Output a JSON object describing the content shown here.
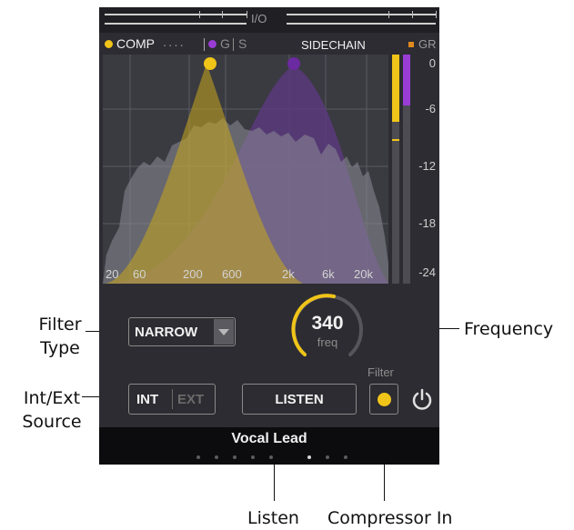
{
  "colors": {
    "accent_yellow": "#f0c419",
    "sidechain_purple": "#9a3cd6",
    "gr_orange": "#e08a1e",
    "panel_bg": "#2c2c32"
  },
  "topbar": {
    "io_label": "I/O"
  },
  "header": {
    "comp_label": "COMP",
    "comp_dots": "....",
    "g_label": "G",
    "s_label": "S",
    "sidechain_label": "SIDECHAIN",
    "gr_label": "GR"
  },
  "graph": {
    "freq_labels": [
      "20",
      "60",
      "200",
      "600",
      "2k",
      "6k",
      "20k"
    ]
  },
  "gr_meter": {
    "ticks": [
      "0",
      "-6",
      "-12",
      "-18",
      "-24"
    ]
  },
  "filter_type": {
    "value": "NARROW"
  },
  "frequency_knob": {
    "value": "340",
    "unit": "freq"
  },
  "source": {
    "int_label": "INT",
    "ext_label": "EXT"
  },
  "listen_button": {
    "label": "LISTEN"
  },
  "compressor_in": {
    "label": "Filter"
  },
  "footer": {
    "preset_name": "Vocal Lead",
    "page_count": 8,
    "current_page": 6
  },
  "callouts": {
    "filter_type": [
      "Filter",
      "Type"
    ],
    "source": [
      "Int/Ext",
      "Source"
    ],
    "frequency": "Frequency",
    "listen": "Listen",
    "compressor_in": "Compressor In"
  }
}
